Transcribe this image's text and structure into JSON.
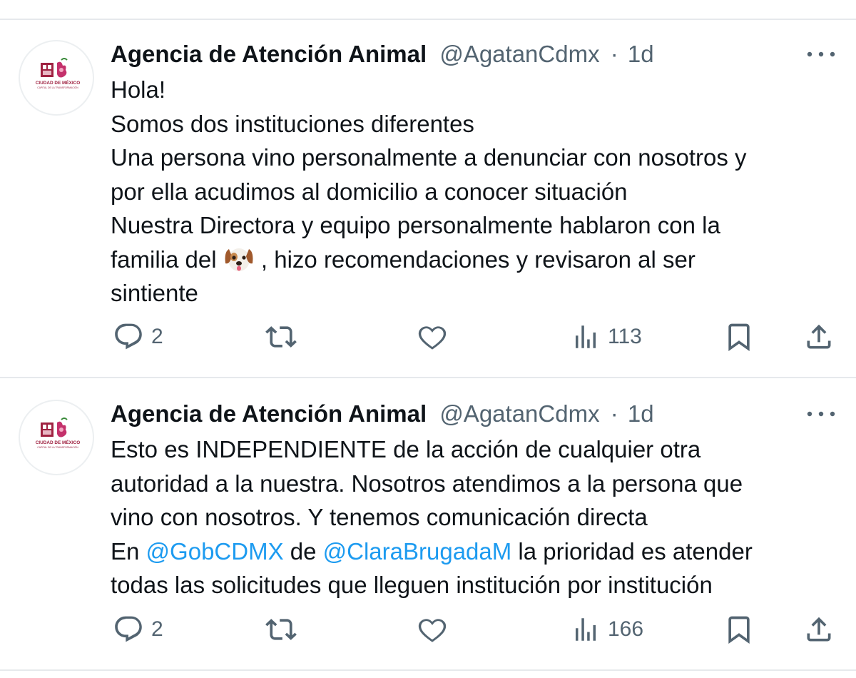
{
  "tweets": [
    {
      "author_name": "Agencia de Atención Animal",
      "handle": "@AgatanCdmx",
      "separator": "·",
      "time": "1d",
      "avatar_text": {
        "line1": "CIUDAD DE MÉXICO",
        "line2": "CAPITAL DE LA TRANSFORMACIÓN"
      },
      "lines": [
        "Hola!",
        "Somos dos instituciones diferentes",
        "Una persona vino personalmente a denunciar con nosotros y",
        "por ella acudimos al domicilio a conocer situación",
        "Nuestra Directora y equipo personalmente hablaron con la"
      ],
      "line6_before": "familia del ",
      "line6_emoji": "dog-face-emoji",
      "line6_after": " , hizo recomendaciones y revisaron al ser",
      "line7": "sintiente",
      "replies": "2",
      "retweets": "",
      "likes": "",
      "views": "113"
    },
    {
      "author_name": "Agencia de Atención Animal",
      "handle": "@AgatanCdmx",
      "separator": "·",
      "time": "1d",
      "avatar_text": {
        "line1": "CIUDAD DE MÉXICO",
        "line2": "CAPITAL DE LA TRANSFORMACIÓN"
      },
      "lines": [
        "Esto es INDEPENDIENTE de la acción de cualquier otra",
        "autoridad a la nuestra. Nosotros atendimos a la persona que",
        "vino con nosotros. Y tenemos comunicación directa"
      ],
      "line4_prefix": "En ",
      "mention1": "@GobCDMX",
      "line4_mid": " de ",
      "mention2": "@ClaraBrugadaM",
      "line4_suffix": " la prioridad es atender",
      "line5": "todas las solicitudes que lleguen institución por institución",
      "replies": "2",
      "retweets": "",
      "likes": "",
      "views": "166"
    }
  ],
  "icons": [
    "more-icon",
    "reply-icon",
    "retweet-icon",
    "like-icon",
    "views-icon",
    "bookmark-icon",
    "share-icon"
  ],
  "colors": {
    "text": "#0f1419",
    "secondary": "#536471",
    "link": "#1d9bf0",
    "brand": "#9f2241",
    "divider": "#e6e9ec"
  }
}
